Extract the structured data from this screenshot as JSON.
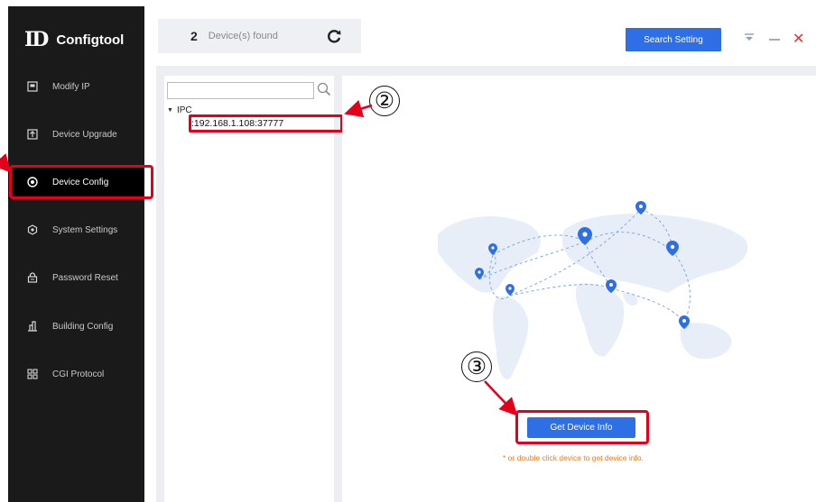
{
  "app": {
    "logo_mark": "ID",
    "title": "Configtool"
  },
  "sidebar": {
    "items": [
      {
        "label": "Modify IP",
        "icon": "ip-icon",
        "active": false
      },
      {
        "label": "Device Upgrade",
        "icon": "upgrade-icon",
        "active": false
      },
      {
        "label": "Device Config",
        "icon": "config-target-icon",
        "active": true
      },
      {
        "label": "System Settings",
        "icon": "settings-hex-icon",
        "active": false
      },
      {
        "label": "Password Reset",
        "icon": "lock-icon",
        "active": false
      },
      {
        "label": "Building Config",
        "icon": "building-icon",
        "active": false
      },
      {
        "label": "CGI Protocol",
        "icon": "grid-icon",
        "active": false
      }
    ]
  },
  "topbar": {
    "count": "2",
    "found_label": "Device(s) found",
    "search_setting": "Search Setting"
  },
  "tree": {
    "search_value": "",
    "root": "IPC",
    "leaf": ":192.168.1.108:37777"
  },
  "main": {
    "get_device_info": "Get Device Info",
    "hint": "* or double click device to get device info."
  },
  "callouts": {
    "two": "②",
    "three": "③"
  },
  "colors": {
    "accent": "#2f6fe6",
    "highlight": "#e3001b",
    "sidebar": "#1a1a1a",
    "hint": "#f07a1c"
  }
}
